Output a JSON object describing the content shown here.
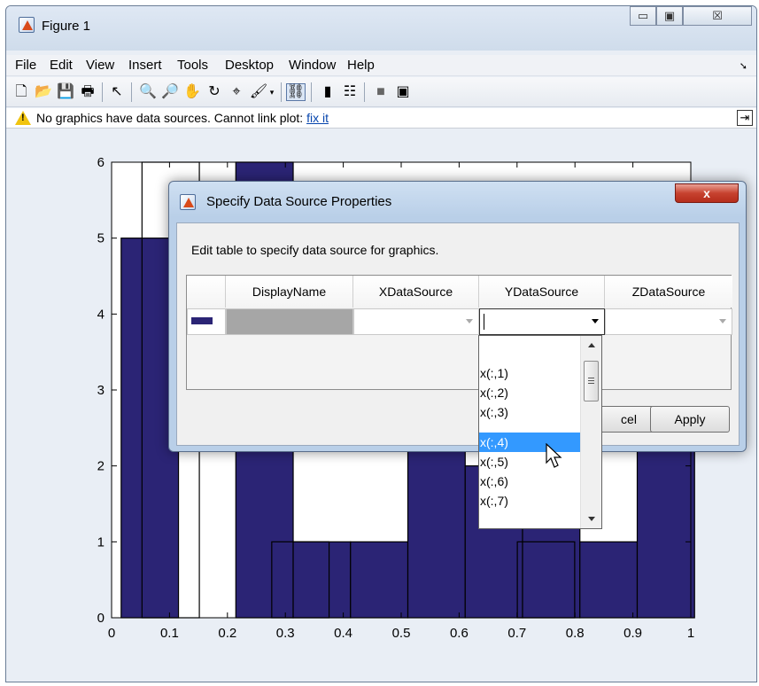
{
  "window": {
    "title": "Figure 1",
    "controls": {
      "minimize": "▭",
      "maximize": "▣",
      "close": "☒"
    }
  },
  "menu": [
    "File",
    "Edit",
    "View",
    "Insert",
    "Tools",
    "Desktop",
    "Window",
    "Help"
  ],
  "toolbar": {
    "icons": [
      "new-figure-icon",
      "open-file-icon",
      "save-icon",
      "print-icon",
      "pointer-icon",
      "zoom-in-icon",
      "zoom-out-icon",
      "pan-icon",
      "rotate-3d-icon",
      "data-cursor-icon",
      "brush-icon",
      "brush-dropdown-icon",
      "link-plot-icon",
      "insert-colorbar-icon",
      "insert-legend-icon",
      "hide-plot-tools-icon",
      "show-plot-tools-icon"
    ]
  },
  "warning": {
    "text": "No graphics have data sources. Cannot link plot: ",
    "link": "fix it"
  },
  "chart_data": {
    "type": "bar",
    "x": [
      0.066,
      0.165,
      0.264,
      0.363,
      0.462,
      0.561,
      0.66,
      0.759,
      0.858,
      0.957
    ],
    "values": [
      5,
      0,
      6,
      1,
      1,
      3,
      2,
      3,
      1,
      4
    ],
    "overlay_rects": [
      [
        0.102,
        6
      ],
      [
        0.326,
        1
      ],
      [
        0.75,
        1
      ]
    ],
    "xlim": [
      0,
      1
    ],
    "ylim": [
      0,
      6
    ],
    "xticks": [
      "0",
      "0.1",
      "0.2",
      "0.3",
      "0.4",
      "0.5",
      "0.6",
      "0.7",
      "0.8",
      "0.9",
      "1"
    ],
    "yticks": [
      "0",
      "1",
      "2",
      "3",
      "4",
      "5",
      "6"
    ],
    "bar_color": "#2b2475"
  },
  "dialog": {
    "title": "Specify Data Source Properties",
    "close": "x",
    "instruction": "Edit table to specify data source for graphics.",
    "columns": [
      "DisplayName",
      "XDataSource",
      "YDataSource",
      "ZDataSource"
    ],
    "buttons": {
      "cancel": "cel",
      "apply": "Apply"
    }
  },
  "dropdown": {
    "items": [
      "x(:,1)",
      "x(:,2)",
      "x(:,3)",
      "x(:,4)",
      "x(:,5)",
      "x(:,6)",
      "x(:,7)"
    ],
    "selected": "x(:,4)"
  }
}
